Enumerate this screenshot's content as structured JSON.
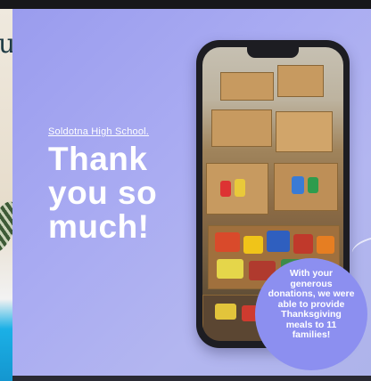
{
  "slide": {
    "school": "Soldotna High School.",
    "headline": [
      "Thank",
      "you so",
      "much!"
    ],
    "circle_message": [
      "With your",
      "generous",
      "donations, we were",
      "able to provide",
      "Thanksgiving",
      "meals to 11",
      "families!"
    ]
  },
  "photo": {
    "subject": "boxes of donated canned food"
  }
}
